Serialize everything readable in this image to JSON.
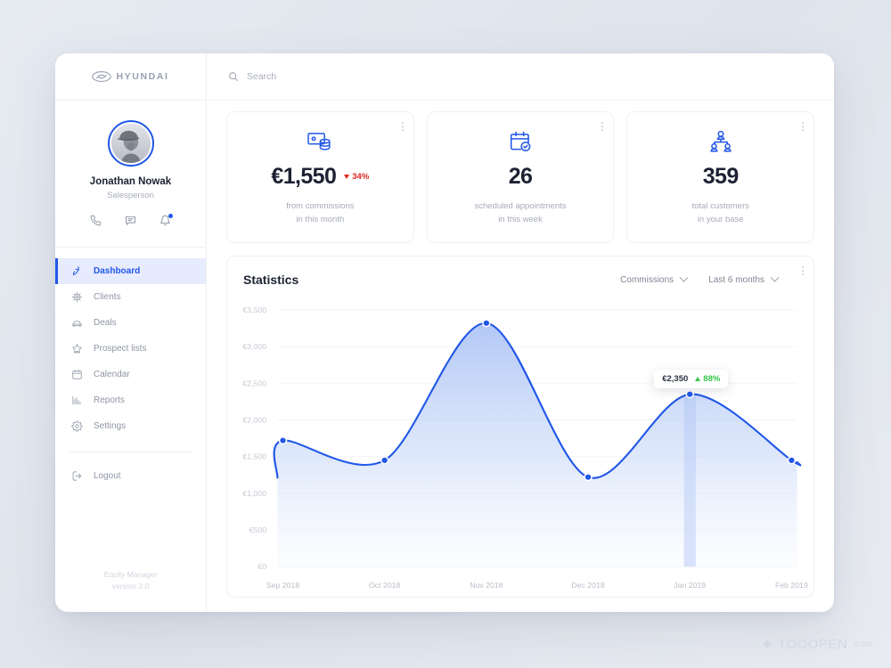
{
  "brand": {
    "name": "HYUNDAI",
    "logo_icon": "hyundai-logo-icon"
  },
  "search": {
    "placeholder": "Search",
    "value": "",
    "icon": "search-icon"
  },
  "profile": {
    "name": "Jonathan Nowak",
    "role": "Salesperson",
    "avatar_alt": "avatar",
    "actions": [
      {
        "name": "phone-icon",
        "label": "Call"
      },
      {
        "name": "message-icon",
        "label": "Message"
      },
      {
        "name": "bell-icon",
        "label": "Notifications",
        "has_badge": true
      }
    ]
  },
  "sidebar": {
    "items": [
      {
        "label": "Dashboard",
        "icon": "dashboard-icon",
        "active": true
      },
      {
        "label": "Clients",
        "icon": "clients-icon",
        "active": false
      },
      {
        "label": "Deals",
        "icon": "car-icon",
        "active": false
      },
      {
        "label": "Prospect lists",
        "icon": "star-list-icon",
        "active": false
      },
      {
        "label": "Calendar",
        "icon": "calendar-icon",
        "active": false
      },
      {
        "label": "Reports",
        "icon": "bar-chart-icon",
        "active": false
      },
      {
        "label": "Settings",
        "icon": "gear-icon",
        "active": false
      }
    ],
    "logout": {
      "label": "Logout",
      "icon": "logout-icon"
    },
    "footer": {
      "line1": "Equity Manager",
      "line2": "version 2.0"
    }
  },
  "stats": [
    {
      "icon": "money-cash-icon",
      "value": "€1,550",
      "delta": "34%",
      "delta_direction": "down",
      "delta_color": "#e0261f",
      "caption_line1": "from commissions",
      "caption_line2": "in this month",
      "menu_icon": "kebab-menu-icon"
    },
    {
      "icon": "calendar-check-icon",
      "value": "26",
      "delta": "",
      "delta_direction": "",
      "delta_color": "",
      "caption_line1": "scheduled appointments",
      "caption_line2": "in this week",
      "menu_icon": "kebab-menu-icon"
    },
    {
      "icon": "customers-group-icon",
      "value": "359",
      "delta": "",
      "delta_direction": "",
      "delta_color": "",
      "caption_line1": "total customers",
      "caption_line2": "in your base",
      "menu_icon": "kebab-menu-icon"
    }
  ],
  "panel": {
    "title": "Statistics",
    "metric_dropdown": "Commissions",
    "range_dropdown": "Last 6 months",
    "menu_icon": "kebab-menu-icon"
  },
  "tooltip": {
    "value": "€2,350",
    "delta": "88%",
    "delta_direction": "up",
    "delta_color": "#37c24a"
  },
  "theme": {
    "accent": "#2157e8",
    "accent_light": "#c3d3f7",
    "text_dark": "#1c2233",
    "text_muted": "#a6abb8",
    "negative": "#e0261f",
    "positive": "#37c24a",
    "page_bg": "#e3e7ee"
  },
  "watermark": {
    "text": "TOOOPEN",
    "suffix": ".com",
    "icon": "tooopen-logo-icon"
  },
  "chart_data": {
    "type": "area",
    "title": "Statistics",
    "xlabel": "",
    "ylabel": "",
    "grid": true,
    "legend": "none",
    "currency": "€",
    "categories": [
      "Sep 2018",
      "Oct 2018",
      "Nov 2018",
      "Dec 2018",
      "Jan 2019",
      "Feb 2019"
    ],
    "values": [
      1720,
      1450,
      3320,
      1220,
      2350,
      1450
    ],
    "ylim": [
      0,
      3500
    ],
    "yticks": [
      0,
      500,
      1000,
      1500,
      2000,
      2500,
      3000,
      3500
    ],
    "ytick_labels": [
      "€0",
      "€500",
      "€1,000",
      "€1,500",
      "€2,000",
      "€2,500",
      "€3,000",
      "€3,500"
    ],
    "highlight_index": 4,
    "highlight_label": "€2,350",
    "series_color": "#2157e8"
  }
}
